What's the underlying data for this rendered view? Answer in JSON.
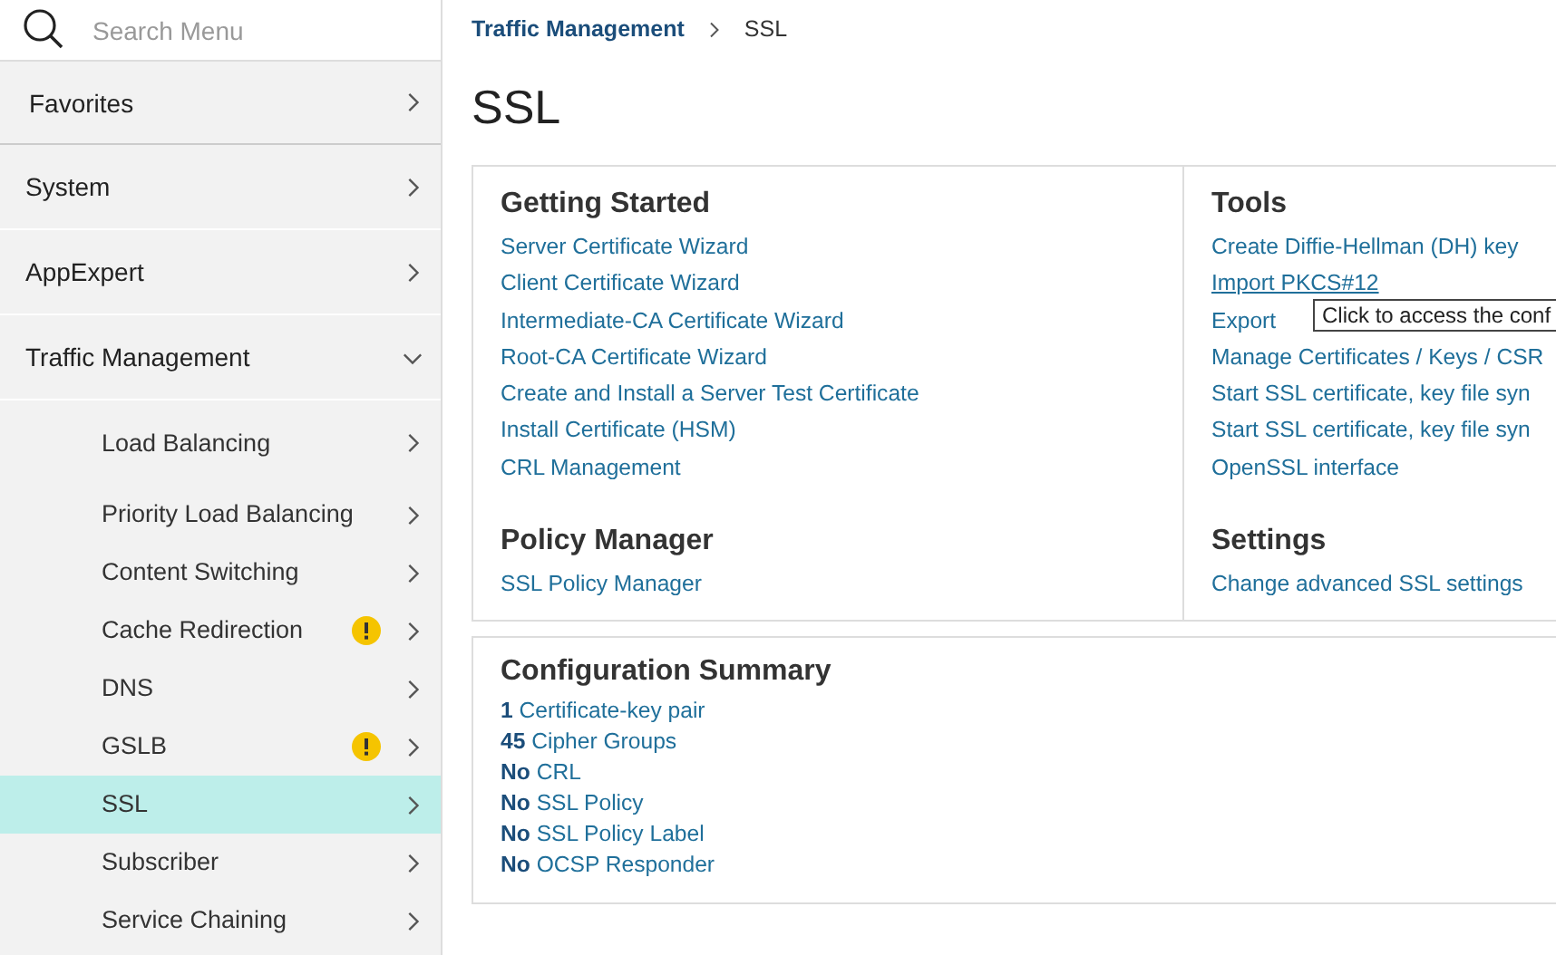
{
  "sidebar": {
    "search": {
      "placeholder": "Search Menu"
    },
    "items": [
      {
        "label": "Favorites",
        "expanded": false,
        "kind": "favorites"
      },
      {
        "label": "System",
        "expanded": false,
        "kind": "section"
      },
      {
        "label": "AppExpert",
        "expanded": false,
        "kind": "section"
      },
      {
        "label": "Traffic Management",
        "expanded": true,
        "kind": "section",
        "children": [
          {
            "label": "Load Balancing",
            "selected": false,
            "warning": false
          },
          {
            "label": "Priority Load Balancing",
            "selected": false,
            "warning": false
          },
          {
            "label": "Content Switching",
            "selected": false,
            "warning": false
          },
          {
            "label": "Cache Redirection",
            "selected": false,
            "warning": true
          },
          {
            "label": "DNS",
            "selected": false,
            "warning": false
          },
          {
            "label": "GSLB",
            "selected": false,
            "warning": true
          },
          {
            "label": "SSL",
            "selected": true,
            "warning": false
          },
          {
            "label": "Subscriber",
            "selected": false,
            "warning": false
          },
          {
            "label": "Service Chaining",
            "selected": false,
            "warning": false
          }
        ]
      }
    ]
  },
  "breadcrumb": [
    "Traffic Management",
    "SSL"
  ],
  "page_title": "SSL",
  "panels": [
    {
      "title": "Getting Started",
      "links": [
        "Server Certificate Wizard",
        "Client Certificate Wizard",
        "Intermediate-CA Certificate Wizard",
        "Root-CA Certificate Wizard",
        "Create and Install a Server Test Certificate",
        "Install Certificate (HSM)",
        "CRL Management"
      ]
    },
    {
      "title": "Tools",
      "links": [
        "Create Diffie-Hellman (DH) key",
        "Import PKCS#12",
        "Export",
        "Manage Certificates / Keys / CSR",
        "Start SSL certificate, key file syn",
        "Start SSL certificate, key file syn",
        "OpenSSL interface"
      ]
    },
    {
      "title": "Policy Manager",
      "links": [
        "SSL Policy Manager"
      ]
    },
    {
      "title": "Settings",
      "links": [
        "Change advanced SSL settings"
      ]
    }
  ],
  "tooltip": "Click to access the conf",
  "summary": {
    "title": "Configuration Summary",
    "rows": [
      {
        "count": "1",
        "label": "Certificate-key pair"
      },
      {
        "count": "45",
        "label": "Cipher Groups"
      },
      {
        "count": "No",
        "label": "CRL"
      },
      {
        "count": "No",
        "label": "SSL Policy"
      },
      {
        "count": "No",
        "label": "SSL Policy Label"
      },
      {
        "count": "No",
        "label": "OCSP Responder"
      }
    ]
  }
}
